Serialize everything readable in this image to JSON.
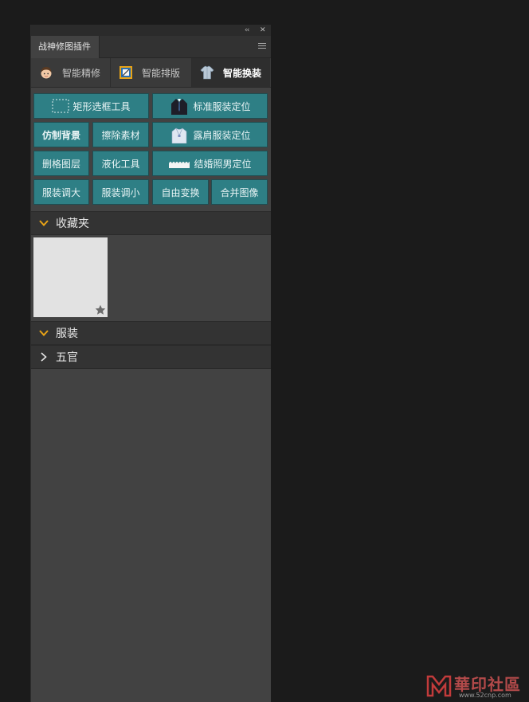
{
  "panel": {
    "title": "战神修图插件",
    "collapse_glyph": "‹‹",
    "close_glyph": "✕",
    "menu_icon": "hamburger-menu-icon"
  },
  "tabs": [
    {
      "label": "智能精修",
      "icon": "face-icon",
      "active": false
    },
    {
      "label": "智能排版",
      "icon": "layout-frame-icon",
      "active": false
    },
    {
      "label": "智能换装",
      "icon": "shirt-icon",
      "active": true
    }
  ],
  "buttons": {
    "rect_select": "矩形选框工具",
    "std_clothes": "标准服装定位",
    "clone_bg": "仿制背景",
    "erase": "擦除素材",
    "shoulder_clothes": "露肩服装定位",
    "delete_layer": "删格图层",
    "liquify": "液化工具",
    "wedding": "结婚照男定位",
    "enlarge": "服装调大",
    "shrink": "服装调小",
    "transform": "自由变换",
    "merge": "合并图像"
  },
  "sections": {
    "favorites": {
      "label": "收藏夹",
      "expanded": true
    },
    "clothing": {
      "label": "服装",
      "expanded": true
    },
    "features": {
      "label": "五官",
      "expanded": false
    }
  },
  "colors": {
    "button": "#2e7f85",
    "chevron_expanded": "#e8a317",
    "panel_bg": "#424242"
  },
  "watermark": {
    "text": "華印社區",
    "url": "www.52cnp.com"
  }
}
